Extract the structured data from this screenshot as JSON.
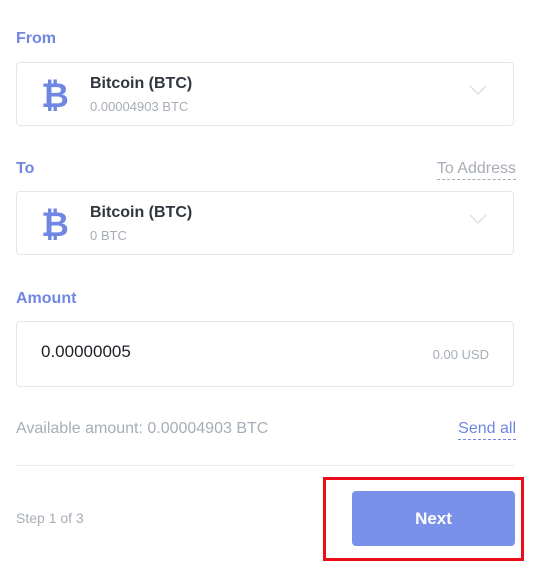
{
  "from": {
    "label": "From",
    "coin_name": "Bitcoin (BTC)",
    "balance": "0.00004903 BTC",
    "icon": "bitcoin-icon"
  },
  "to": {
    "label": "To",
    "to_address_link": "To Address",
    "coin_name": "Bitcoin (BTC)",
    "balance": "0 BTC",
    "icon": "bitcoin-icon"
  },
  "amount": {
    "label": "Amount",
    "value": "0.00000005",
    "fiat_value": "0.00 USD"
  },
  "available": {
    "text": "Available amount: 0.00004903 BTC",
    "send_all_label": "Send all"
  },
  "footer": {
    "step_text": "Step 1 of 3",
    "next_label": "Next"
  },
  "colors": {
    "accent": "#6f87e2",
    "button": "#7991e8",
    "highlight": "#ea0e1b"
  }
}
